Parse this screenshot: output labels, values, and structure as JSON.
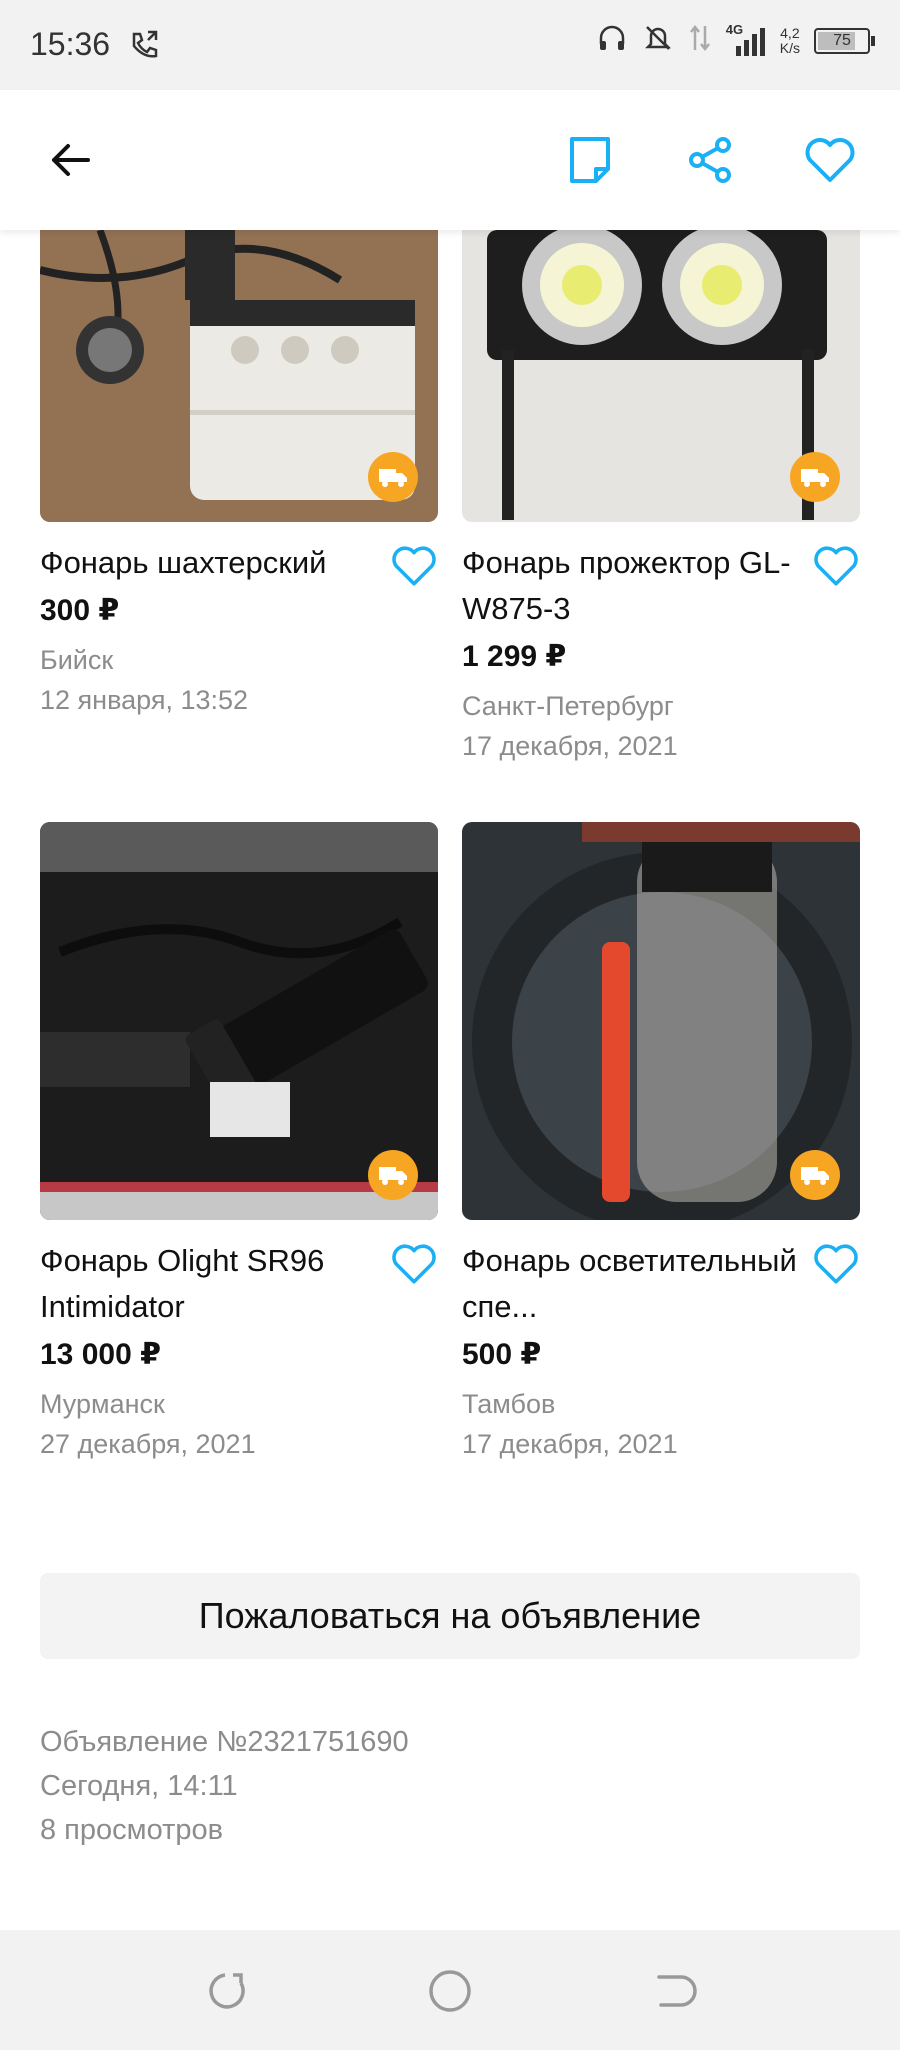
{
  "status_bar": {
    "time": "15:36",
    "network": "4G",
    "speed_value": "4,2",
    "speed_unit": "K/s",
    "battery": "75"
  },
  "appbar": {
    "back_icon": "arrow-left-icon",
    "note_icon": "note-icon",
    "share_icon": "share-icon",
    "favorite_icon": "heart-outline-icon",
    "accent_color": "#1ab0f5"
  },
  "listings": [
    {
      "title": "Фонарь шахтерский",
      "price": "300 ₽",
      "city": "Бийск",
      "date": "12 января, 13:52"
    },
    {
      "title": "Фонарь прожектор GL-W875-3",
      "price": "1 299 ₽",
      "city": "Санкт-Петербург",
      "date": "17 декабря, 2021"
    },
    {
      "title": "Фонарь Olight SR96 Intimidator",
      "price": "13 000 ₽",
      "city": "Мурманск",
      "date": "27 декабря, 2021"
    },
    {
      "title": "Фонарь осветительный спе...",
      "price": "500 ₽",
      "city": "Тамбов",
      "date": "17 декабря, 2021"
    }
  ],
  "report_button": "Пожаловаться на объявление",
  "ad_info": {
    "number": "Объявление №2321751690",
    "date": "Сегодня, 14:11",
    "views": "8 просмотров"
  },
  "delivery_badge_color": "#f6a623"
}
